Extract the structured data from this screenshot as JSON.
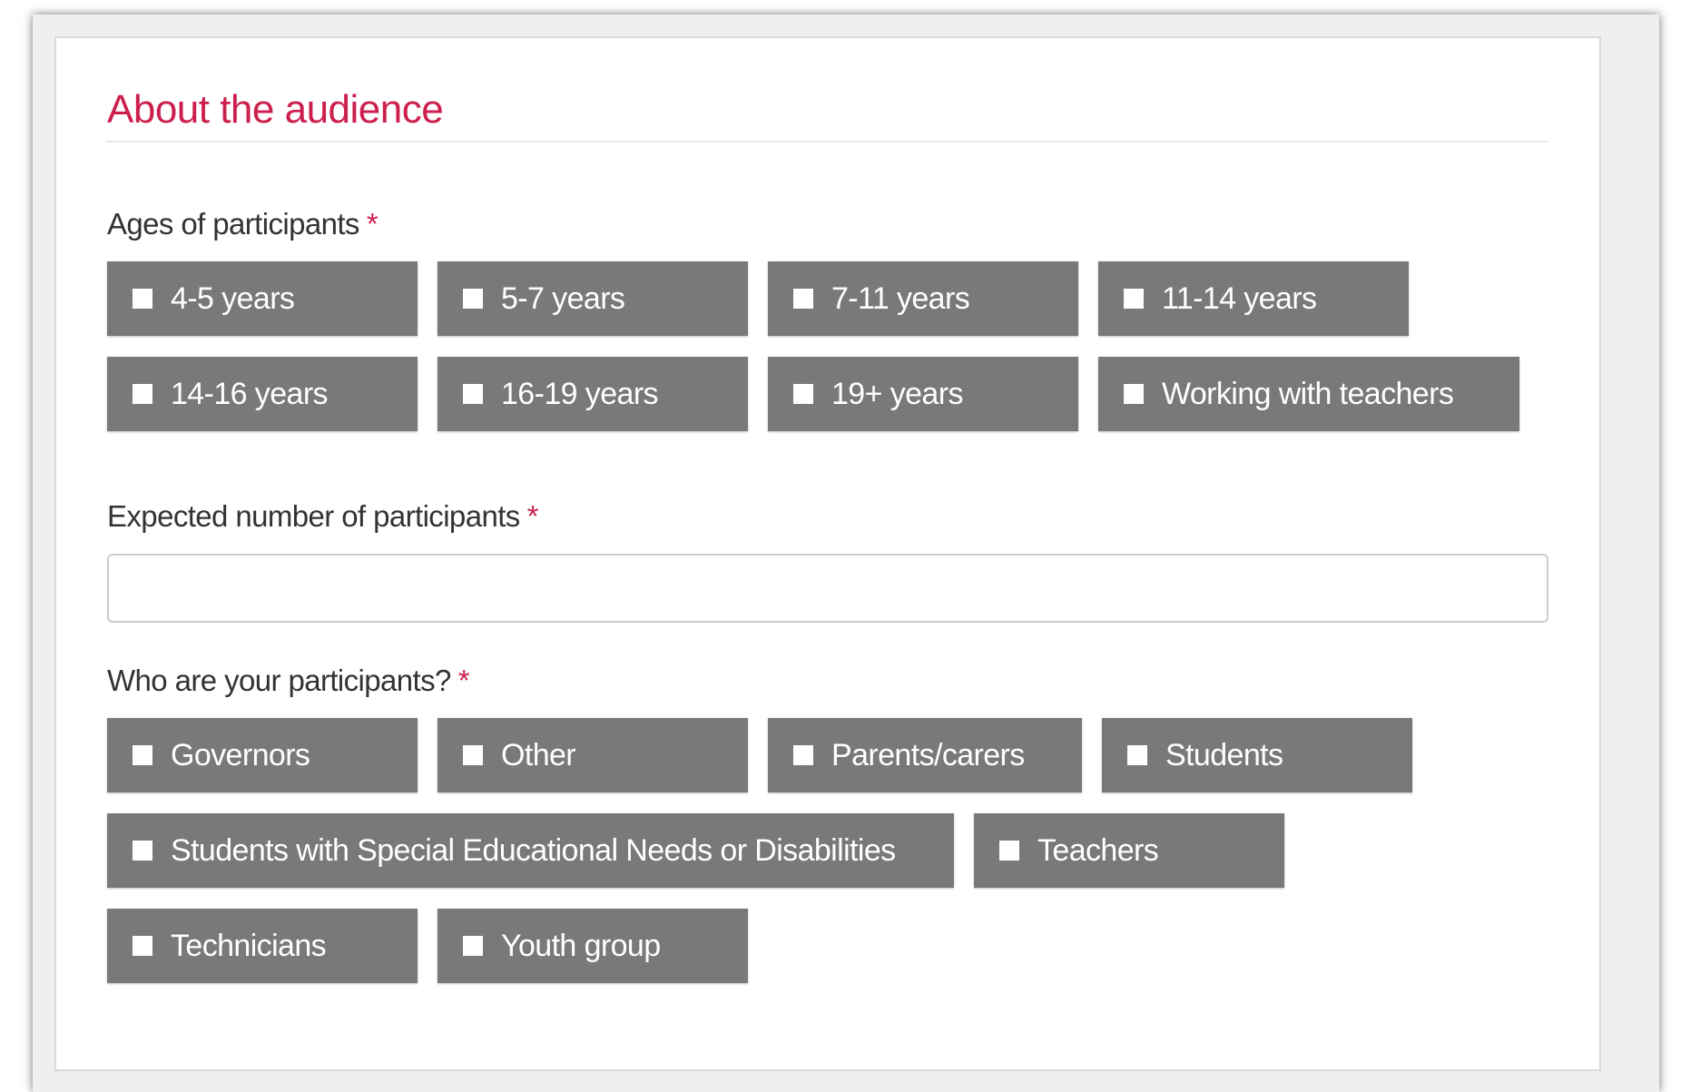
{
  "section": {
    "title": "About the audience"
  },
  "ages": {
    "label": "Ages of participants",
    "required_mark": "*",
    "options": [
      "4-5 years",
      "5-7 years",
      "7-11 years",
      "11-14 years",
      "14-16 years",
      "16-19 years",
      "19+ years",
      "Working with teachers"
    ]
  },
  "expected": {
    "label": "Expected number of participants",
    "required_mark": "*",
    "value": ""
  },
  "who": {
    "label": "Who are your participants?",
    "required_mark": "*",
    "options": [
      "Governors",
      "Other",
      "Parents/carers",
      "Students",
      "Students with Special Educational Needs or Disabilities",
      "Teachers",
      "Technicians",
      "Youth group"
    ]
  },
  "colors": {
    "accent": "#cc1f4e",
    "chip_background": "#7a7878",
    "chip_text": "#ffffff"
  },
  "icons": {
    "checkbox": "checkbox-icon"
  }
}
